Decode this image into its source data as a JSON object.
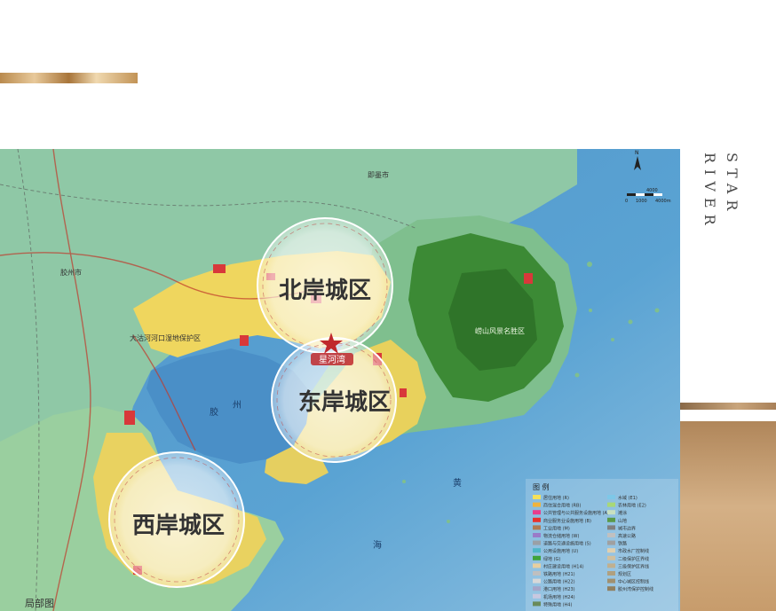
{
  "side_title": [
    "STAR",
    "RIVER"
  ],
  "districts": [
    {
      "label": "北岸城区"
    },
    {
      "label": "东岸城区"
    },
    {
      "label": "西岸城区"
    }
  ],
  "brand_label": "星河湾",
  "map_labels": {
    "jiaozhou": "胶州市",
    "jimo": "即墨市",
    "wetland": "大沽河河口湿地保护区",
    "laoshan": "崂山风景名胜区",
    "bay_jiao": "胶",
    "bay_zhou": "州",
    "sea_huang": "黄",
    "sea_hai": "海"
  },
  "legend": {
    "title": "图 例",
    "items": [
      {
        "label": "居住用地 (R)",
        "color": "#f5e15a"
      },
      {
        "label": "商住混合用地 (RB)",
        "color": "#f0b33c"
      },
      {
        "label": "公共管理与公共服务设施用地 (A)",
        "color": "#e83e8c"
      },
      {
        "label": "商业服务业设施用地 (B)",
        "color": "#e8322c"
      },
      {
        "label": "工业用地 (M)",
        "color": "#b07a52"
      },
      {
        "label": "物流仓储用地 (W)",
        "color": "#9a7bc8"
      },
      {
        "label": "道路与交通设施用地 (S)",
        "color": "#9aa0a6"
      },
      {
        "label": "公用设施用地 (U)",
        "color": "#4fb6c8"
      },
      {
        "label": "绿地 (G)",
        "color": "#3fa33a"
      },
      {
        "label": "村庄建设用地 (H14)",
        "color": "#e7cfa0"
      },
      {
        "label": "铁路用地 (H21)",
        "color": "#bfbfbf"
      },
      {
        "label": "公路用地 (H22)",
        "color": "#d8d8d8"
      },
      {
        "label": "港口用地 (H23)",
        "color": "#a5a5c8"
      },
      {
        "label": "机场用地 (H24)",
        "color": "#c8c8e0"
      },
      {
        "label": "特殊用地 (H4)",
        "color": "#6a8a5a"
      },
      {
        "label": "水域 (E1)",
        "color": "#7ec8e8"
      },
      {
        "label": "农林用地 (E2)",
        "color": "#a8d878"
      },
      {
        "label": "滩涂",
        "color": "#c8e0c0"
      },
      {
        "label": "山地",
        "color": "#5a9a4a"
      },
      {
        "label": "城市边界",
        "color": "#808080"
      },
      {
        "label": "高速公路",
        "color": "#c0c0c0"
      },
      {
        "label": "铁路",
        "color": "#a0a0a0"
      },
      {
        "label": "市政水厂控制线",
        "color": "#e0d0b0"
      },
      {
        "label": "二级保护区界线",
        "color": "#d0c0a0"
      },
      {
        "label": "三级保护区界线",
        "color": "#c0b090"
      },
      {
        "label": "规划区",
        "color": "#b0a080"
      },
      {
        "label": "中心城区控制线",
        "color": "#a09070"
      },
      {
        "label": "胶州湾保护控制线",
        "color": "#908060"
      }
    ]
  },
  "scale_bar": {
    "labels": [
      "0",
      "1000",
      "4000",
      "4000m"
    ]
  },
  "corner_label": "局部图",
  "colors": {
    "sea": "#5a9ecf",
    "sea_deep": "#3d7fb8",
    "land": "#8ec9a8",
    "mountain": "#3f8a36",
    "urban": "#f0d65a",
    "gold": "#c49a66"
  }
}
